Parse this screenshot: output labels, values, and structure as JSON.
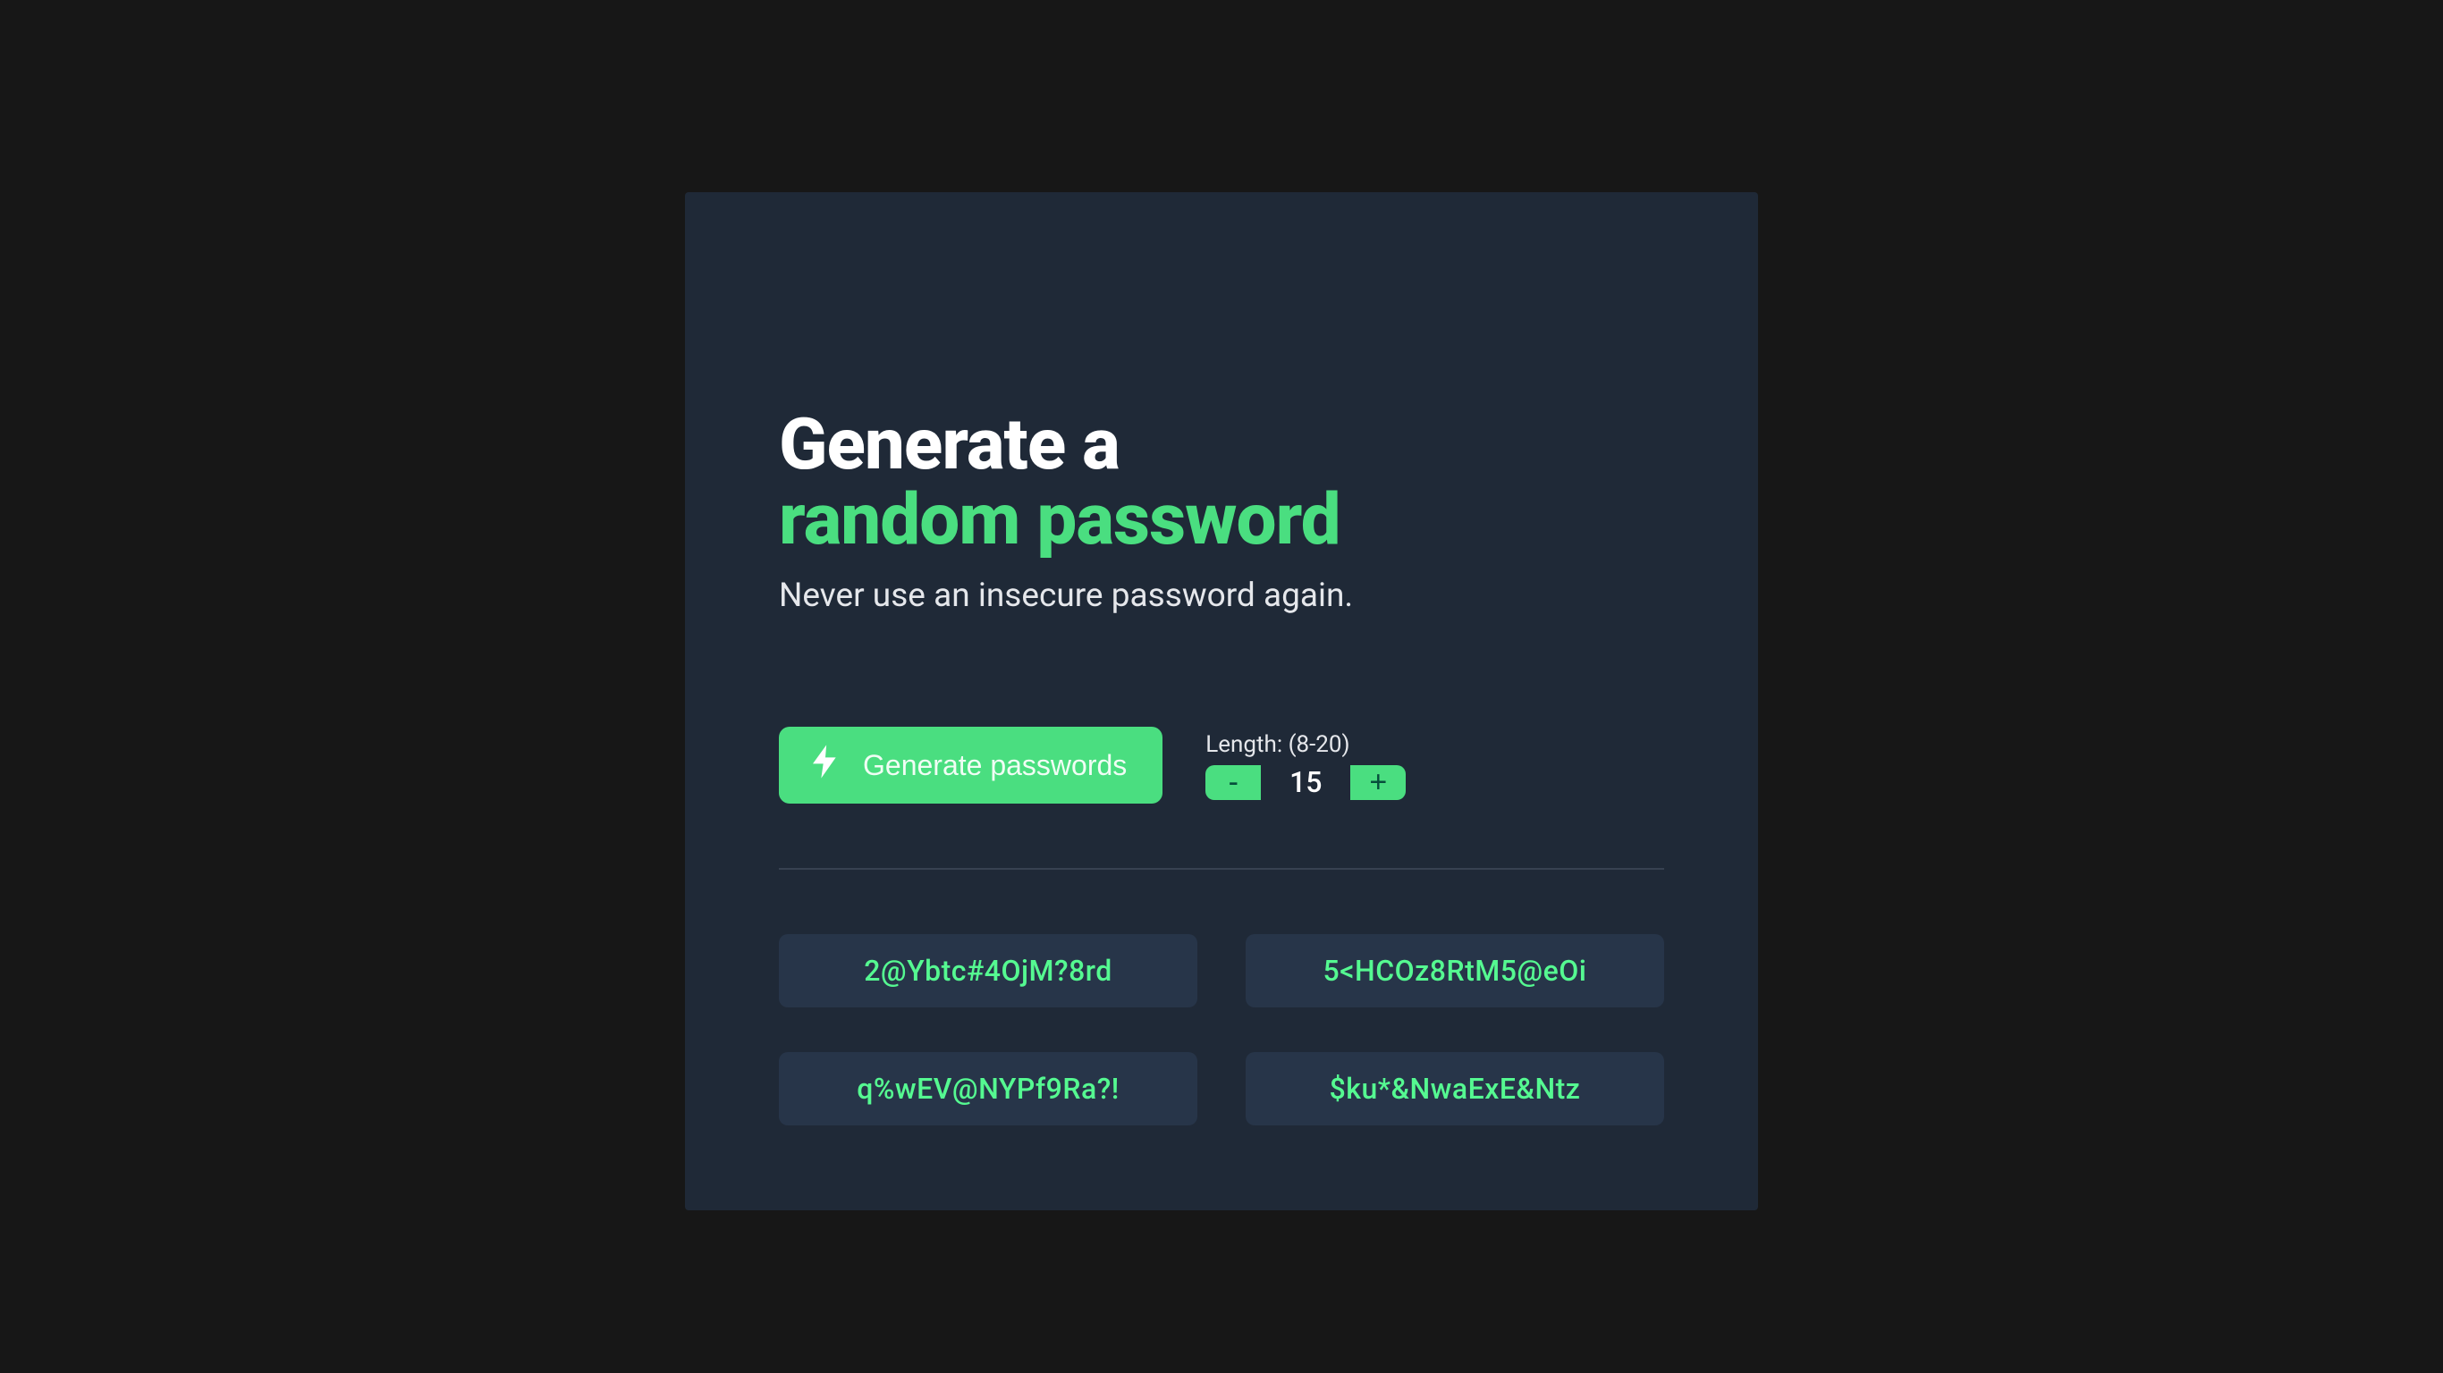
{
  "header": {
    "title_line1": "Generate a",
    "title_line2": "random password",
    "subtitle": "Never use an insecure password again."
  },
  "controls": {
    "generate_label": "Generate passwords",
    "length_label": "Length: (8-20)",
    "minus_label": "-",
    "plus_label": "+",
    "length_value": "15"
  },
  "passwords": {
    "slot1": "2@Ybtc#4OjM?8rd",
    "slot2": "5<HCOz8RtM5@eOi",
    "slot3": "q%wEV@NYPf9Ra?!",
    "slot4": "$ku*&NwaExE&Ntz"
  }
}
